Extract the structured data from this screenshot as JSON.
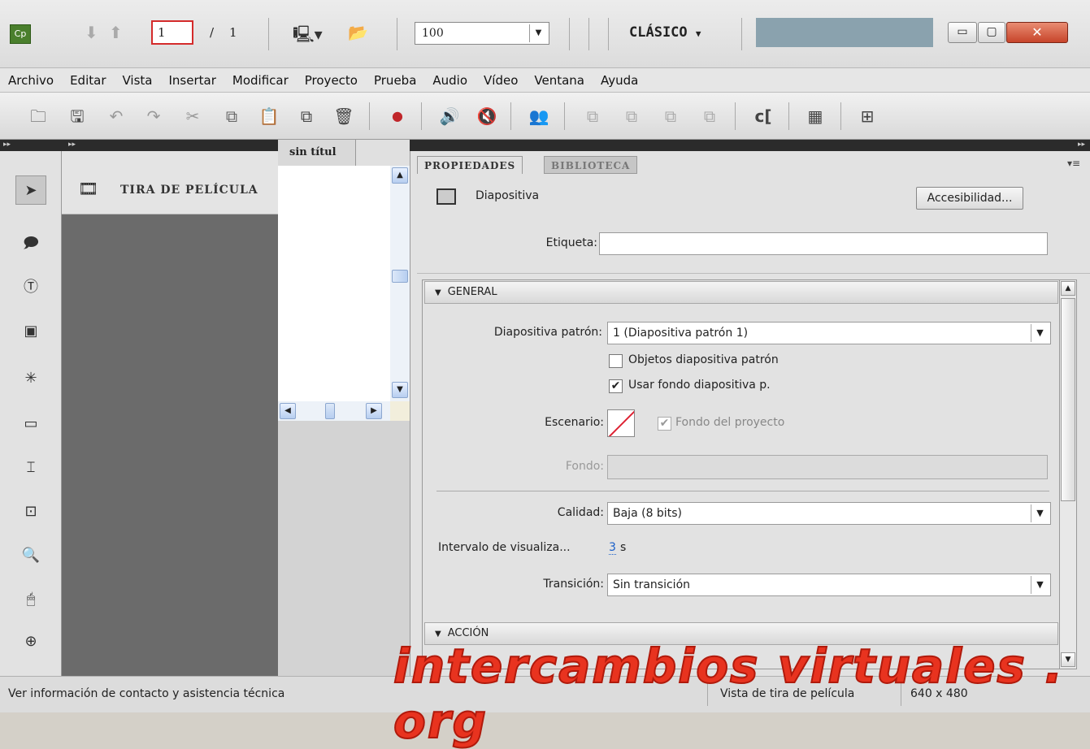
{
  "titlebar": {
    "page_current": "1",
    "page_sep": "/",
    "page_total": "1",
    "zoom": "100",
    "workspace": "CLÁSICO"
  },
  "menu": [
    "Archivo",
    "Editar",
    "Vista",
    "Insertar",
    "Modificar",
    "Proyecto",
    "Prueba",
    "Audio",
    "Vídeo",
    "Ventana",
    "Ayuda"
  ],
  "filmstrip": {
    "title": "TIRA DE PELÍCULA"
  },
  "doc": {
    "tab": "sin títul"
  },
  "props": {
    "tab_properties": "PROPIEDADES",
    "tab_library": "BIBLIOTECA",
    "object_type": "Diapositiva",
    "accessibility_button": "Accesibilidad...",
    "label_label": "Etiqueta:",
    "label_value": "",
    "general_title": "GENERAL",
    "master_label": "Diapositiva patrón:",
    "master_value": "1 (Diapositiva patrón 1)",
    "master_objects": "Objetos diapositiva patrón",
    "master_objects_checked": false,
    "use_bg": "Usar fondo diapositiva p.",
    "use_bg_checked": true,
    "stage_label": "Escenario:",
    "project_bg": "Fondo del proyecto",
    "project_bg_checked": true,
    "bg_label": "Fondo:",
    "quality_label": "Calidad:",
    "quality_value": "Baja (8 bits)",
    "interval_label": "Intervalo de visualiza...",
    "interval_value": "3",
    "interval_unit": "s",
    "transition_label": "Transición:",
    "transition_value": "Sin transición",
    "action_title": "ACCIÓN"
  },
  "status": {
    "left": "Ver información de contacto y asistencia técnica",
    "view": "Vista de tira de película",
    "size": "640 x 480"
  },
  "watermark": "intercambios virtuales . org"
}
